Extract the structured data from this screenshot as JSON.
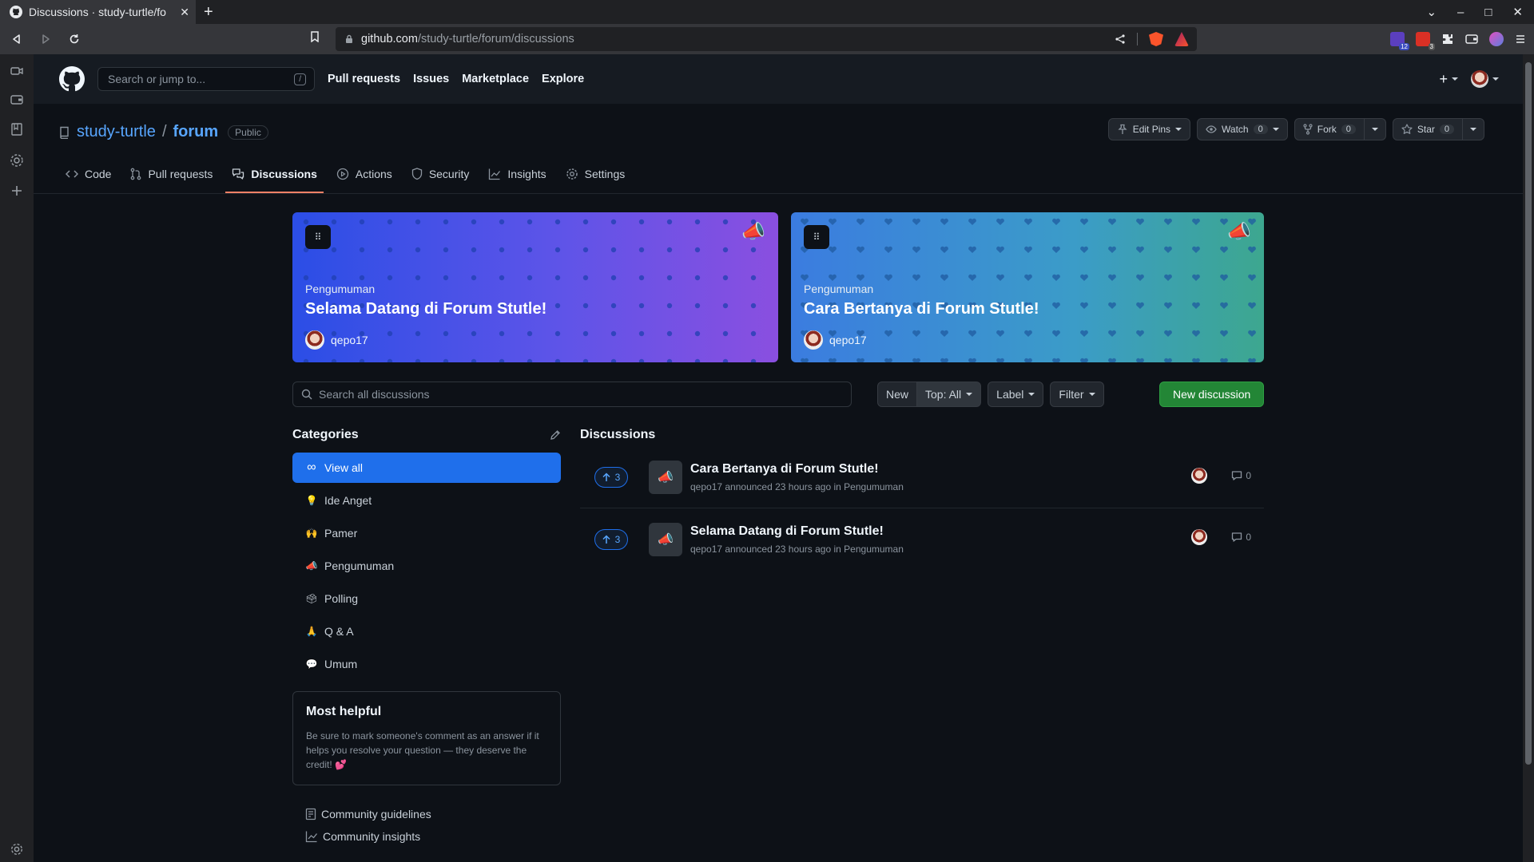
{
  "browser": {
    "tab_title": "Discussions · study-turtle/fo",
    "url_host": "github.com",
    "url_path": "/study-turtle/forum/discussions",
    "ext_badges": [
      "2",
      "12",
      "3"
    ]
  },
  "header": {
    "search_placeholder": "Search or jump to...",
    "slash_key": "/",
    "nav": [
      "Pull requests",
      "Issues",
      "Marketplace",
      "Explore"
    ]
  },
  "repo": {
    "owner": "study-turtle",
    "separator": "/",
    "name": "forum",
    "visibility": "Public",
    "edit_pins_label": "Edit Pins",
    "watch_label": "Watch",
    "watch_count": "0",
    "fork_label": "Fork",
    "fork_count": "0",
    "star_label": "Star",
    "star_count": "0"
  },
  "tabs": [
    "Code",
    "Pull requests",
    "Discussions",
    "Actions",
    "Security",
    "Insights",
    "Settings"
  ],
  "active_tab": "Discussions",
  "pins": [
    {
      "category": "Pengumuman",
      "title": "Selama Datang di Forum Stutle!",
      "author": "qepo17"
    },
    {
      "category": "Pengumuman",
      "title": "Cara Bertanya di Forum Stutle!",
      "author": "qepo17"
    }
  ],
  "toolbar": {
    "search_placeholder": "Search all discussions",
    "new_label": "New",
    "top_label": "Top: All",
    "label_label": "Label",
    "filter_label": "Filter",
    "new_discussion_label": "New discussion"
  },
  "categories": {
    "heading": "Categories",
    "items": [
      {
        "emoji": "∞",
        "label": "View all"
      },
      {
        "emoji": "💡",
        "label": "Ide Anget"
      },
      {
        "emoji": "🙌",
        "label": "Pamer"
      },
      {
        "emoji": "📣",
        "label": "Pengumuman"
      },
      {
        "emoji": "🗳",
        "label": "Polling"
      },
      {
        "emoji": "🙏",
        "label": "Q & A"
      },
      {
        "emoji": "💬",
        "label": "Umum"
      }
    ]
  },
  "most_helpful": {
    "title": "Most helpful",
    "text": "Be sure to mark someone's comment as an answer if it helps you resolve your question — they deserve the credit! 💕"
  },
  "community": [
    "Community guidelines",
    "Community insights"
  ],
  "discussions": {
    "heading": "Discussions",
    "items": [
      {
        "votes": "3",
        "title": "Cara Bertanya di Forum Stutle!",
        "meta": "qepo17 announced 23 hours ago in Pengumuman",
        "comments": "0"
      },
      {
        "votes": "3",
        "title": "Selama Datang di Forum Stutle!",
        "meta": "qepo17 announced 23 hours ago in Pengumuman",
        "comments": "0"
      }
    ]
  },
  "colors": {
    "accent": "#1f6feb",
    "primary_button": "#238636",
    "active_tab_underline": "#f78166",
    "link": "#58a6ff"
  }
}
